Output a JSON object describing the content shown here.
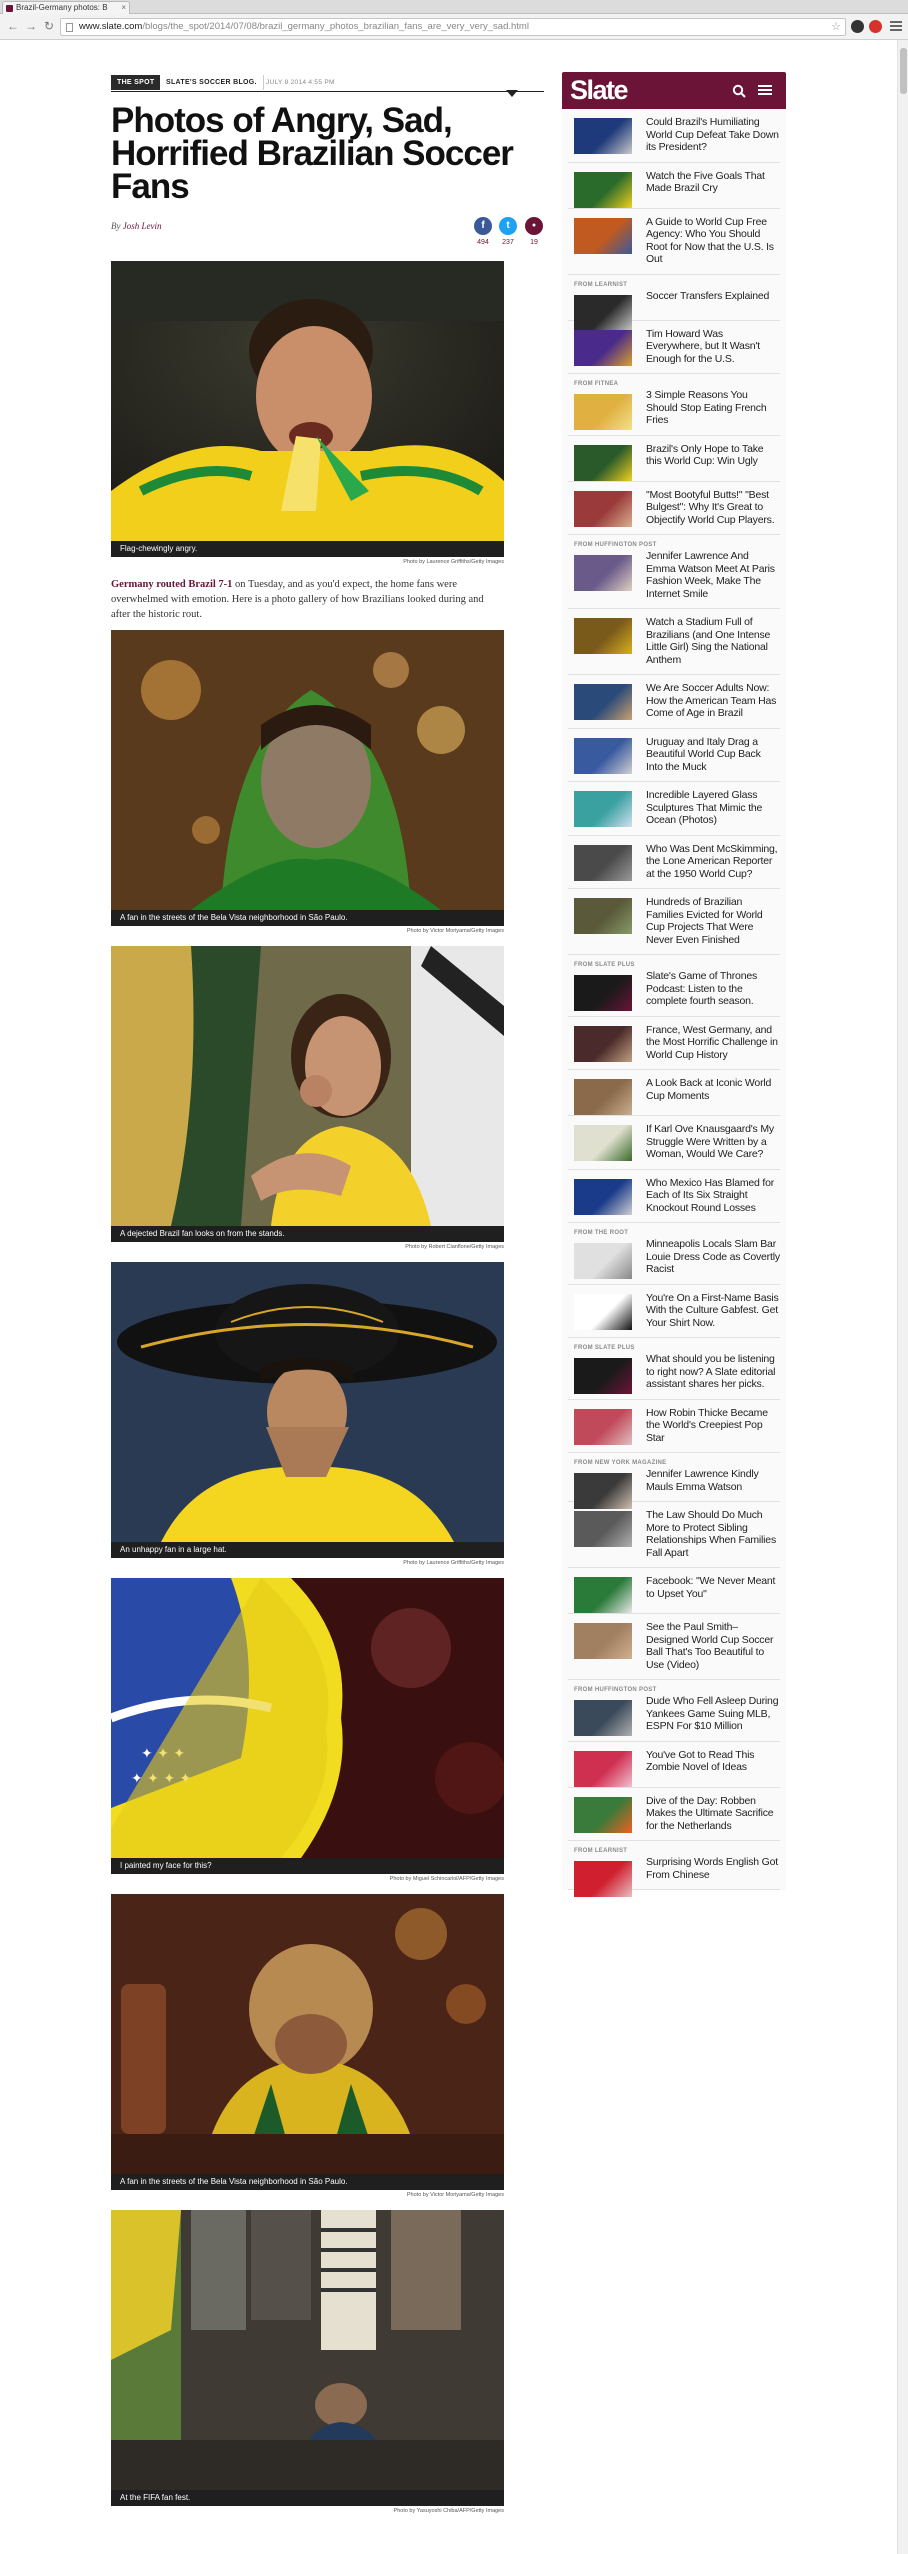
{
  "browser": {
    "tab_title": "Brazil-Germany photos: B",
    "url_host": "www.slate.com",
    "url_path": "/blogs/the_spot/2014/07/08/brazil_germany_photos_brazilian_fans_are_very_very_sad.html",
    "back_icon": "back-arrow-icon",
    "forward_icon": "forward-arrow-icon",
    "reload_icon": "reload-icon",
    "star_icon": "star-icon"
  },
  "article": {
    "tag_section": "THE SPOT",
    "tag_blog": "SLATE'S SOCCER BLOG.",
    "date": "JULY 8 2014 4:55 PM",
    "headline": "Photos of Angry, Sad, Horrified Brazilian Soccer Fans",
    "byline_prefix": "By",
    "author": "Josh Levin",
    "shares": [
      {
        "network": "facebook",
        "icon": "facebook-icon",
        "glyph": "f",
        "count": "494",
        "color": "#3b5998"
      },
      {
        "network": "twitter",
        "icon": "twitter-icon",
        "glyph": "t",
        "count": "237",
        "color": "#1da1f2"
      },
      {
        "network": "comments",
        "icon": "comment-icon",
        "glyph": "●",
        "count": "19",
        "color": "#6b1437"
      }
    ],
    "intro_link": "Germany routed Brazil 7-1",
    "intro_text": " on Tuesday, and as you'd expect, the home fans were overwhelmed with emotion. Here is a photo gallery of how Brazilians looked during and after the historic rout.",
    "photos": [
      {
        "caption": "Flag-chewingly angry.",
        "credit": "Photo by Laurence Griffiths/Getty Images"
      },
      {
        "caption": "A fan in the streets of the Bela Vista neighborhood in São Paulo.",
        "credit": "Photo by Victor Moriyama/Getty Images"
      },
      {
        "caption": "A dejected Brazil fan looks on from the stands.",
        "credit": "Photo by Robert Cianflone/Getty Images"
      },
      {
        "caption": "An unhappy fan in a large hat.",
        "credit": "Photo by Laurence Griffiths/Getty Images"
      },
      {
        "caption": "I painted my face for this?",
        "credit": "Photo by Miguel Schincariol/AFP/Getty Images"
      },
      {
        "caption": "A fan in the streets of the Bela Vista neighborhood in São Paulo.",
        "credit": "Photo by Victor Moriyama/Getty Images"
      },
      {
        "caption": "At the FIFA fan fest.",
        "credit": "Photo by Yasuyoshi Chiba/AFP/Getty Images"
      }
    ]
  },
  "sidebar": {
    "logo": "Slate",
    "accent_color": "#6b1437",
    "items": [
      {
        "sponsor": "",
        "title": "Could Brazil's Humiliating World Cup Defeat Take Down its President?"
      },
      {
        "sponsor": "",
        "title": "Watch the Five Goals That Made Brazil Cry"
      },
      {
        "sponsor": "",
        "title": "A Guide to World Cup Free Agency: Who You Should Root for Now that the U.S. Is Out"
      },
      {
        "sponsor": "FROM LEARNIST",
        "title": "Soccer Transfers Explained"
      },
      {
        "sponsor": "",
        "title": "Tim Howard Was Everywhere, but It Wasn't Enough for the U.S."
      },
      {
        "sponsor": "FROM FITNEA",
        "title": "3 Simple Reasons You Should Stop Eating French Fries"
      },
      {
        "sponsor": "",
        "title": "Brazil's Only Hope to Take this World Cup: Win Ugly"
      },
      {
        "sponsor": "",
        "title": "\"Most Bootyful Butts!\" \"Best Bulgest\": Why It's Great to Objectify World Cup Players."
      },
      {
        "sponsor": "FROM HUFFINGTON POST",
        "title": "Jennifer Lawrence And Emma Watson Meet At Paris Fashion Week, Make The Internet Smile"
      },
      {
        "sponsor": "",
        "title": "Watch a Stadium Full of Brazilians (and One Intense Little Girl) Sing the National Anthem"
      },
      {
        "sponsor": "",
        "title": "We Are Soccer Adults Now: How the American Team Has Come of Age in Brazil"
      },
      {
        "sponsor": "",
        "title": "Uruguay and Italy Drag a Beautiful World Cup Back Into the Muck"
      },
      {
        "sponsor": "",
        "title": "Incredible Layered Glass Sculptures That Mimic the Ocean (Photos)"
      },
      {
        "sponsor": "",
        "title": "Who Was Dent McSkimming, the Lone American Reporter at the 1950 World Cup?"
      },
      {
        "sponsor": "",
        "title": "Hundreds of Brazilian Families Evicted for World Cup Projects That Were Never Even Finished"
      },
      {
        "sponsor": "FROM SLATE PLUS",
        "title": "Slate's Game of Thrones Podcast: Listen to the complete fourth season."
      },
      {
        "sponsor": "",
        "title": "France, West Germany, and the Most Horrific Challenge in World Cup History"
      },
      {
        "sponsor": "",
        "title": "A Look Back at Iconic World Cup Moments"
      },
      {
        "sponsor": "",
        "title": "If Karl Ove Knausgaard's My Struggle Were Written by a Woman, Would We Care?"
      },
      {
        "sponsor": "",
        "title": "Who Mexico Has Blamed for Each of Its Six Straight Knockout Round Losses"
      },
      {
        "sponsor": "FROM THE ROOT",
        "title": "Minneapolis Locals Slam Bar Louie Dress Code as Covertly Racist"
      },
      {
        "sponsor": "",
        "title": "You're On a First-Name Basis With the Culture Gabfest. Get Your Shirt Now."
      },
      {
        "sponsor": "FROM SLATE PLUS",
        "title": "What should you be listening to right now? A Slate editorial assistant shares her picks."
      },
      {
        "sponsor": "",
        "title": "How Robin Thicke Became the World's Creepiest Pop Star"
      },
      {
        "sponsor": "FROM NEW YORK MAGAZINE",
        "title": "Jennifer Lawrence Kindly Mauls Emma Watson"
      },
      {
        "sponsor": "",
        "title": "The Law Should Do Much More to Protect Sibling Relationships When Families Fall Apart"
      },
      {
        "sponsor": "",
        "title": "Facebook: \"We Never Meant to Upset You\""
      },
      {
        "sponsor": "",
        "title": "See the Paul Smith–Designed World Cup Soccer Ball That's Too Beautiful to Use (Video)"
      },
      {
        "sponsor": "FROM HUFFINGTON POST",
        "title": "Dude Who Fell Asleep During Yankees Game Suing MLB, ESPN For $10 Million"
      },
      {
        "sponsor": "",
        "title": "You've Got to Read This Zombie Novel of Ideas"
      },
      {
        "sponsor": "",
        "title": "Dive of the Day: Robben Makes the Ultimate Sacrifice for the Netherlands"
      },
      {
        "sponsor": "FROM LEARNIST",
        "title": "Surprising Words English Got From Chinese"
      }
    ]
  }
}
